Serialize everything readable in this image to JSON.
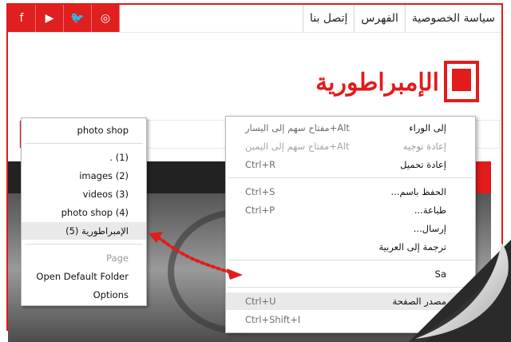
{
  "header": {
    "social": [
      {
        "name": "facebook-icon",
        "glyph": "f"
      },
      {
        "name": "youtube-icon",
        "glyph": "▶"
      },
      {
        "name": "twitter-icon",
        "glyph": "🐦"
      },
      {
        "name": "instagram-icon",
        "glyph": "◎"
      }
    ],
    "nav": [
      "سياسة الخصوصية",
      "الفهرس",
      "إتصل بنا"
    ]
  },
  "logo": {
    "text": "الإمبراطورية"
  },
  "left_menu": {
    "items": [
      {
        "label": "photo shop",
        "state": "normal"
      },
      {
        "label": ". (1)",
        "state": "normal"
      },
      {
        "label": "images (2)",
        "state": "normal"
      },
      {
        "label": "videos (3)",
        "state": "normal"
      },
      {
        "label": "photo shop (4)",
        "state": "normal"
      },
      {
        "label": "الإمبراطورية (5)",
        "state": "highlighted"
      },
      {
        "label": "Page",
        "state": "disabled"
      },
      {
        "label": "Open Default Folder",
        "state": "normal"
      },
      {
        "label": "Options",
        "state": "normal"
      }
    ]
  },
  "right_menu": {
    "items": [
      {
        "label": "إلى الوراء",
        "shortcut": "مفتاح سهم إلى اليسار+Alt",
        "state": "normal"
      },
      {
        "label": "إعادة توجيه",
        "shortcut": "مفتاح سهم إلى اليمين+Alt",
        "state": "disabled"
      },
      {
        "label": "إعادة تحميل",
        "shortcut": "Ctrl+R",
        "state": "normal"
      },
      {
        "label": "الحفظ باسم...",
        "shortcut": "Ctrl+S",
        "state": "normal"
      },
      {
        "label": "طباعة...",
        "shortcut": "Ctrl+P",
        "state": "normal"
      },
      {
        "label": "إرسال...",
        "shortcut": "",
        "state": "normal"
      },
      {
        "label": "ترجمة إلى العربية",
        "shortcut": "",
        "state": "normal"
      },
      {
        "label": "Sa",
        "shortcut": "",
        "state": "normal"
      },
      {
        "label": "مصدر الصفحة",
        "shortcut": "Ctrl+U",
        "state": "highlighted"
      },
      {
        "label": "",
        "shortcut": "Ctrl+Shift+I",
        "state": "normal"
      }
    ]
  },
  "colors": {
    "accent": "#e21b1b",
    "menu_highlight": "#e9e9e9"
  }
}
